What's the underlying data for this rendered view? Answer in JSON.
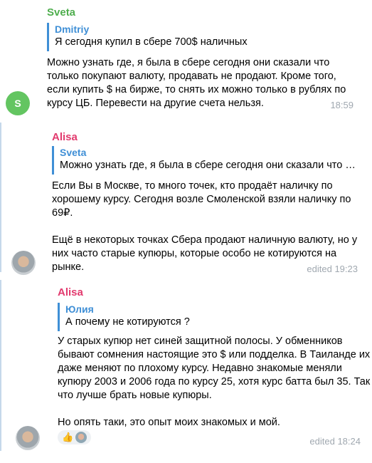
{
  "messages": [
    {
      "sender": "Sveta",
      "sender_color": "#4fae4e",
      "reply_to": {
        "name": "Dmitriy",
        "text": "Я сегодня купил в сбере 700$ наличных"
      },
      "text": "Можно узнать где, я была в сбере сегодня они сказали что\nтолько покупают валюту, продавать не продают. Кроме того,\nесли купить $ на бирже, то снять их можно только в рублях по\nкурсу ЦБ. Перевести на другие счета нельзя.",
      "time": "18:59",
      "avatar_initial": "S"
    },
    {
      "sender": "Alisa",
      "sender_color": "#e23a6e",
      "reply_to": {
        "name": "Sveta",
        "text": "Можно узнать где, я была в сбере сегодня они сказали что то..."
      },
      "text": "Если Вы в Москве, то много точек, кто продаёт наличку по\nхорошему курсу. Сегодня возле Смоленской взяли наличку по\n69₽.\n\nЕщё в некоторых точках Сбера продают наличную валюту, но у\nних часто старые купюры, которые особо не котируются на\nрынке.",
      "time": "edited 19:23"
    },
    {
      "sender": "Alisa",
      "sender_color": "#e23a6e",
      "reply_to": {
        "name": "Юлия",
        "text": "А почему не котируются ?"
      },
      "text": "У старых купюр нет синей защитной полосы. У обменников\nбывают сомнения настоящие это $ или подделка. В Таиланде их\nдаже меняют по плохому курсу. Недавно знакомые меняли\nкупюру 2003 и 2006 года по курсу 25, хотя курс батта был 35. Так\nчто лучше брать новые купюры.\n\nНо опять таки, это опыт моих знакомых и мой.",
      "time": "edited 18:24",
      "reaction_icon": "thumbs-up-icon",
      "reaction_glyph": "👍"
    }
  ],
  "colors": {
    "reply_accent": "#3f8fd6",
    "time": "#a0a8b0"
  }
}
